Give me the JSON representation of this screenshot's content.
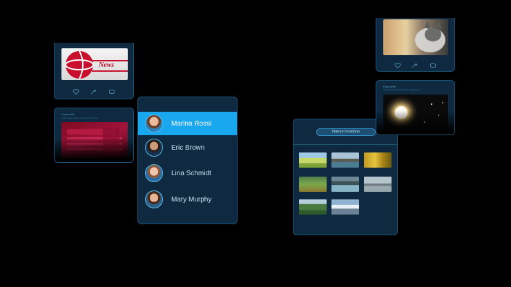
{
  "contacts": [
    {
      "name": "Marina Rossi",
      "active": true
    },
    {
      "name": "Eric Brown",
      "active": false
    },
    {
      "name": "Lina Schmidt",
      "active": false
    },
    {
      "name": "Mary Murphy",
      "active": false
    }
  ],
  "gallery": {
    "search_label": "Nature locations",
    "photos": [
      "meadow",
      "lake-rock",
      "autumn-forest",
      "green-valley",
      "mountain-lake",
      "shore-trees",
      "hills-valley",
      "snow-peaks"
    ]
  },
  "news_card": {
    "thumb_text": "News"
  },
  "left_lower_card": {
    "title": "Lorem title",
    "subtitle": "Lorem ipsum dolor sit amet consectetur"
  },
  "right_lower_card": {
    "title": "Party time",
    "subtitle": "Lorem ipsum dolor sit amet consectetur"
  },
  "icons": {
    "like": "heart-icon",
    "share": "share-icon",
    "comment": "comment-icon",
    "search": "search-icon"
  },
  "colors": {
    "accent": "#19a8f0",
    "panel": "#0f2a40",
    "border": "#1d5577",
    "background": "#000000"
  }
}
